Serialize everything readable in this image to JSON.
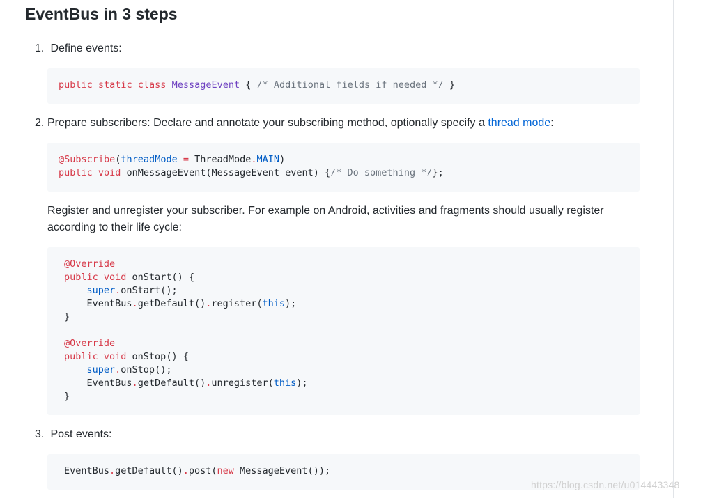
{
  "heading": "EventBus in 3 steps",
  "steps": [
    {
      "num": "1.",
      "text": "Define events:"
    },
    {
      "num": "2.",
      "text_before": "Prepare subscribers: Declare and annotate your subscribing method, optionally specify a ",
      "link": "thread mode",
      "text_after": ":"
    },
    {
      "num": "3.",
      "text": "Post events:"
    }
  ],
  "register_paragraph": "Register and unregister your subscriber. For example on Android, activities and fragments should usually register according to their life cycle:",
  "code1": {
    "kw": "public static class",
    "cls": "MessageEvent",
    "open": "{",
    "comment": "/* Additional fields if needed */",
    "close": "}"
  },
  "code2": {
    "line1": {
      "annotation": "@Subscribe",
      "paren": "(",
      "param": "threadMode",
      "eq": "=",
      "mode": "ThreadMode",
      "dot": ".",
      "main": "MAIN",
      "close": ")"
    },
    "line2": {
      "kw": "public void",
      "rest": "onMessageEvent(MessageEvent event) {",
      "comment": "/* Do something */",
      "end": "};"
    }
  },
  "code3": {
    "override": "@Override",
    "kw": "public void",
    "start_sig": "onStart() {",
    "super": "super",
    "dot": ".",
    "start_call": "onStart();",
    "eventbus": "EventBus",
    "get_default": "getDefault()",
    "register": "register(",
    "this": "this",
    "close_call": ");",
    "close_brace": "}",
    "stop_sig": "onStop() {",
    "stop_call": "onStop();",
    "unregister": "unregister("
  },
  "code4": {
    "eventbus": "EventBus",
    "dot": ".",
    "get_default": "getDefault()",
    "post": "post(",
    "new": "new",
    "rest": "MessageEvent());"
  },
  "watermark": "https://blog.csdn.net/u014443348"
}
